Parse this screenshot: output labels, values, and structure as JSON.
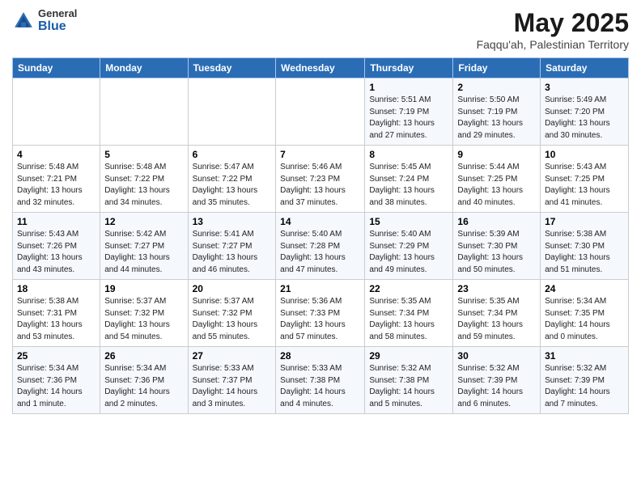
{
  "logo": {
    "general": "General",
    "blue": "Blue"
  },
  "title": "May 2025",
  "subtitle": "Faqqu'ah, Palestinian Territory",
  "days_of_week": [
    "Sunday",
    "Monday",
    "Tuesday",
    "Wednesday",
    "Thursday",
    "Friday",
    "Saturday"
  ],
  "weeks": [
    [
      {
        "num": "",
        "info": ""
      },
      {
        "num": "",
        "info": ""
      },
      {
        "num": "",
        "info": ""
      },
      {
        "num": "",
        "info": ""
      },
      {
        "num": "1",
        "info": "Sunrise: 5:51 AM\nSunset: 7:19 PM\nDaylight: 13 hours and 27 minutes."
      },
      {
        "num": "2",
        "info": "Sunrise: 5:50 AM\nSunset: 7:19 PM\nDaylight: 13 hours and 29 minutes."
      },
      {
        "num": "3",
        "info": "Sunrise: 5:49 AM\nSunset: 7:20 PM\nDaylight: 13 hours and 30 minutes."
      }
    ],
    [
      {
        "num": "4",
        "info": "Sunrise: 5:48 AM\nSunset: 7:21 PM\nDaylight: 13 hours and 32 minutes."
      },
      {
        "num": "5",
        "info": "Sunrise: 5:48 AM\nSunset: 7:22 PM\nDaylight: 13 hours and 34 minutes."
      },
      {
        "num": "6",
        "info": "Sunrise: 5:47 AM\nSunset: 7:22 PM\nDaylight: 13 hours and 35 minutes."
      },
      {
        "num": "7",
        "info": "Sunrise: 5:46 AM\nSunset: 7:23 PM\nDaylight: 13 hours and 37 minutes."
      },
      {
        "num": "8",
        "info": "Sunrise: 5:45 AM\nSunset: 7:24 PM\nDaylight: 13 hours and 38 minutes."
      },
      {
        "num": "9",
        "info": "Sunrise: 5:44 AM\nSunset: 7:25 PM\nDaylight: 13 hours and 40 minutes."
      },
      {
        "num": "10",
        "info": "Sunrise: 5:43 AM\nSunset: 7:25 PM\nDaylight: 13 hours and 41 minutes."
      }
    ],
    [
      {
        "num": "11",
        "info": "Sunrise: 5:43 AM\nSunset: 7:26 PM\nDaylight: 13 hours and 43 minutes."
      },
      {
        "num": "12",
        "info": "Sunrise: 5:42 AM\nSunset: 7:27 PM\nDaylight: 13 hours and 44 minutes."
      },
      {
        "num": "13",
        "info": "Sunrise: 5:41 AM\nSunset: 7:27 PM\nDaylight: 13 hours and 46 minutes."
      },
      {
        "num": "14",
        "info": "Sunrise: 5:40 AM\nSunset: 7:28 PM\nDaylight: 13 hours and 47 minutes."
      },
      {
        "num": "15",
        "info": "Sunrise: 5:40 AM\nSunset: 7:29 PM\nDaylight: 13 hours and 49 minutes."
      },
      {
        "num": "16",
        "info": "Sunrise: 5:39 AM\nSunset: 7:30 PM\nDaylight: 13 hours and 50 minutes."
      },
      {
        "num": "17",
        "info": "Sunrise: 5:38 AM\nSunset: 7:30 PM\nDaylight: 13 hours and 51 minutes."
      }
    ],
    [
      {
        "num": "18",
        "info": "Sunrise: 5:38 AM\nSunset: 7:31 PM\nDaylight: 13 hours and 53 minutes."
      },
      {
        "num": "19",
        "info": "Sunrise: 5:37 AM\nSunset: 7:32 PM\nDaylight: 13 hours and 54 minutes."
      },
      {
        "num": "20",
        "info": "Sunrise: 5:37 AM\nSunset: 7:32 PM\nDaylight: 13 hours and 55 minutes."
      },
      {
        "num": "21",
        "info": "Sunrise: 5:36 AM\nSunset: 7:33 PM\nDaylight: 13 hours and 57 minutes."
      },
      {
        "num": "22",
        "info": "Sunrise: 5:35 AM\nSunset: 7:34 PM\nDaylight: 13 hours and 58 minutes."
      },
      {
        "num": "23",
        "info": "Sunrise: 5:35 AM\nSunset: 7:34 PM\nDaylight: 13 hours and 59 minutes."
      },
      {
        "num": "24",
        "info": "Sunrise: 5:34 AM\nSunset: 7:35 PM\nDaylight: 14 hours and 0 minutes."
      }
    ],
    [
      {
        "num": "25",
        "info": "Sunrise: 5:34 AM\nSunset: 7:36 PM\nDaylight: 14 hours and 1 minute."
      },
      {
        "num": "26",
        "info": "Sunrise: 5:34 AM\nSunset: 7:36 PM\nDaylight: 14 hours and 2 minutes."
      },
      {
        "num": "27",
        "info": "Sunrise: 5:33 AM\nSunset: 7:37 PM\nDaylight: 14 hours and 3 minutes."
      },
      {
        "num": "28",
        "info": "Sunrise: 5:33 AM\nSunset: 7:38 PM\nDaylight: 14 hours and 4 minutes."
      },
      {
        "num": "29",
        "info": "Sunrise: 5:32 AM\nSunset: 7:38 PM\nDaylight: 14 hours and 5 minutes."
      },
      {
        "num": "30",
        "info": "Sunrise: 5:32 AM\nSunset: 7:39 PM\nDaylight: 14 hours and 6 minutes."
      },
      {
        "num": "31",
        "info": "Sunrise: 5:32 AM\nSunset: 7:39 PM\nDaylight: 14 hours and 7 minutes."
      }
    ]
  ]
}
